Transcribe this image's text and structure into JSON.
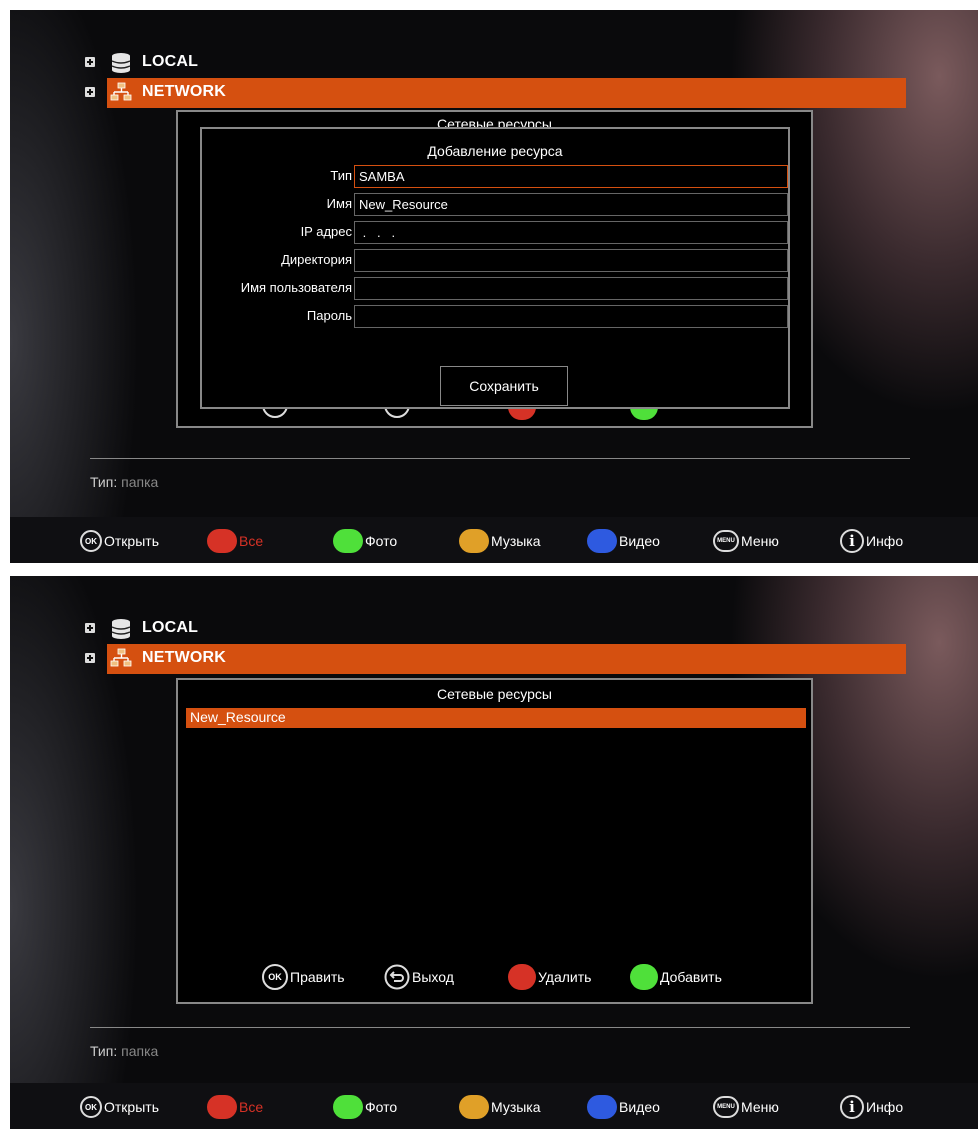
{
  "tree": {
    "local_label": "LOCAL",
    "network_label": "NETWORK"
  },
  "info": {
    "type_key": "Тип:",
    "type_value": " папка"
  },
  "bottom_hints": {
    "ok_badge": "OK",
    "open": "Открыть",
    "all": "Все",
    "photo": "Фото",
    "music": "Музыка",
    "video": "Видео",
    "menu_badge": "MENU",
    "menu": "Меню",
    "info_badge": "i",
    "info": "Инфо"
  },
  "colors": {
    "accent": "#d55010",
    "red": "#d63226",
    "green": "#4fe03a",
    "yellow": "#e0a028",
    "blue": "#2e5ae0"
  },
  "panel": {
    "title": "Сетевые ресурсы",
    "items": [
      "New_Resource"
    ],
    "hints": {
      "edit": "Править",
      "exit": "Выход",
      "delete": "Удалить",
      "add": "Добавить"
    }
  },
  "dialog": {
    "title": "Добавление ресурса",
    "fields": [
      {
        "label": "Тип",
        "value": "SAMBA"
      },
      {
        "label": "Имя",
        "value": "New_Resource"
      },
      {
        "label": "IP адрес",
        "value": " .   .   . "
      },
      {
        "label": "Директория",
        "value": ""
      },
      {
        "label": "Имя пользователя",
        "value": ""
      },
      {
        "label": "Пароль",
        "value": ""
      }
    ],
    "save_label": "Сохранить"
  }
}
